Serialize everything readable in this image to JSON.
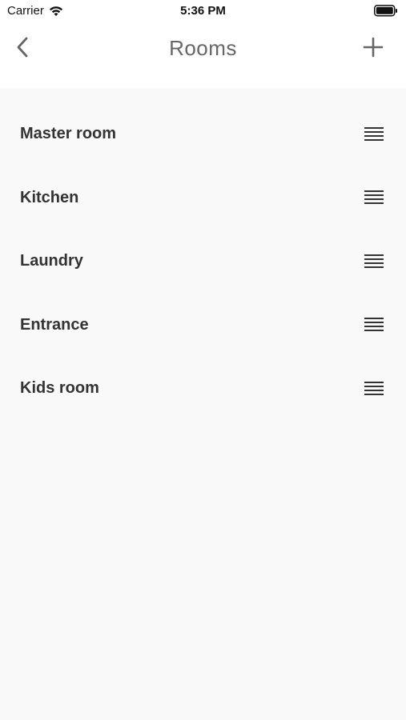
{
  "status_bar": {
    "carrier": "Carrier",
    "time": "5:36 PM",
    "wifi_icon": "wifi-icon",
    "battery_icon": "battery-icon"
  },
  "nav": {
    "title": "Rooms",
    "back_icon": "chevron-left-icon",
    "add_icon": "plus-icon"
  },
  "rooms": [
    {
      "label": "Master room",
      "handle_icon": "drag-handle-icon"
    },
    {
      "label": "Kitchen",
      "handle_icon": "drag-handle-icon"
    },
    {
      "label": "Laundry",
      "handle_icon": "drag-handle-icon"
    },
    {
      "label": "Entrance",
      "handle_icon": "drag-handle-icon"
    },
    {
      "label": "Kids room",
      "handle_icon": "drag-handle-icon"
    }
  ],
  "colors": {
    "background": "#f9f9f9",
    "header": "#ffffff",
    "text": "#333333",
    "title": "#666666"
  }
}
